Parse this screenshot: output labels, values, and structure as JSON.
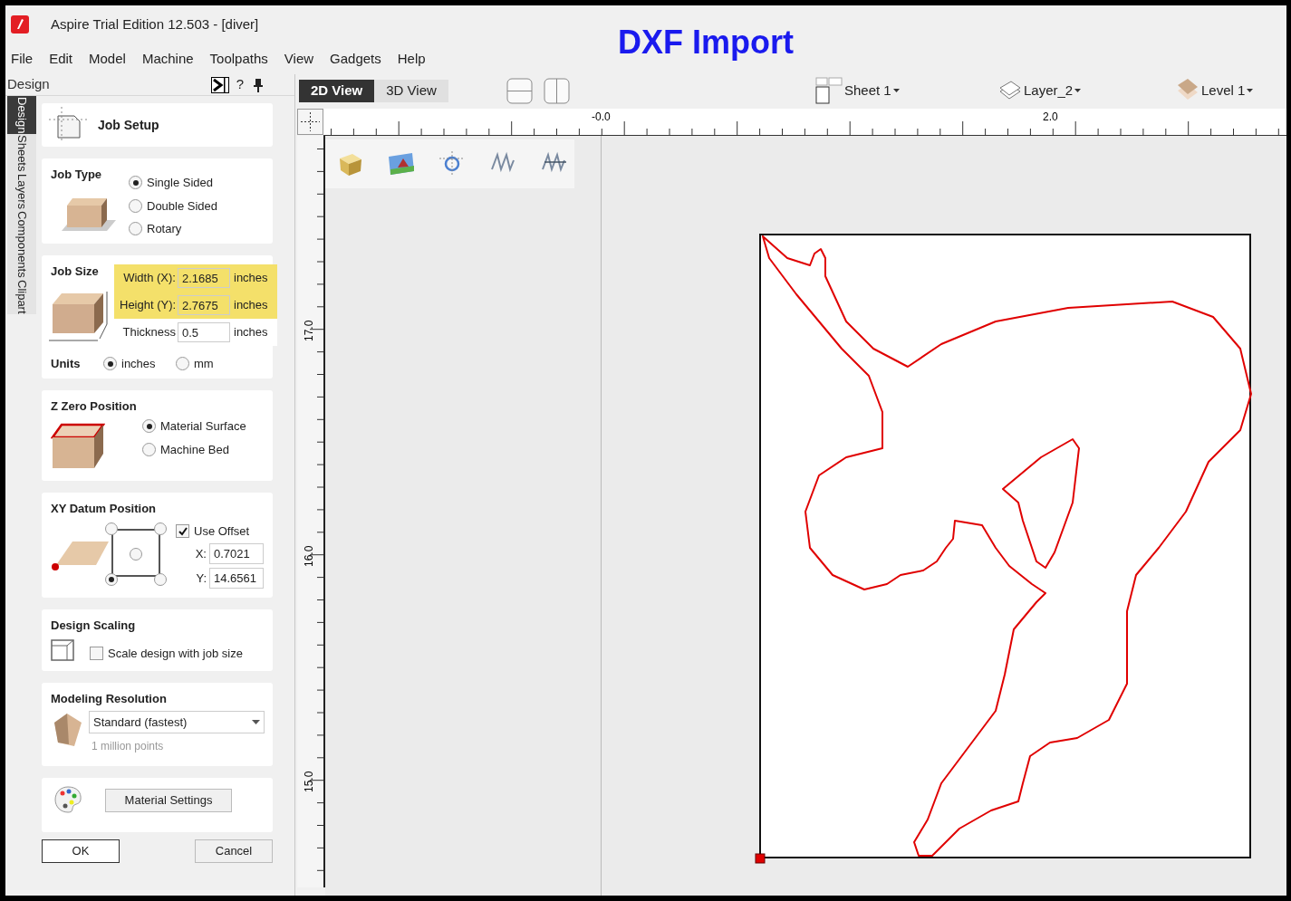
{
  "window": {
    "title": "Aspire Trial Edition 12.503 - [diver]"
  },
  "overlay_heading": "DXF Import",
  "menu": [
    "File",
    "Edit",
    "Model",
    "Machine",
    "Toolpaths",
    "View",
    "Gadgets",
    "Help"
  ],
  "panel": {
    "title": "Design",
    "help": "?",
    "side_tabs": [
      {
        "label": "Design",
        "selected": true
      },
      {
        "label": "Sheets",
        "selected": false
      },
      {
        "label": "Layers",
        "selected": false
      },
      {
        "label": "Components",
        "selected": false
      },
      {
        "label": "Clipart",
        "selected": false
      }
    ],
    "job_setup_title": "Job Setup",
    "job_type": {
      "title": "Job Type",
      "options": [
        {
          "label": "Single Sided",
          "selected": true
        },
        {
          "label": "Double Sided",
          "selected": false
        },
        {
          "label": "Rotary",
          "selected": false
        }
      ]
    },
    "job_size": {
      "title": "Job Size",
      "fields": [
        {
          "label": "Width (X):",
          "value": "2.1685",
          "unit": "inches",
          "highlighted": true
        },
        {
          "label": "Height (Y):",
          "value": "2.7675",
          "unit": "inches",
          "highlighted": true
        },
        {
          "label": "Thickness",
          "value": "0.5",
          "unit": "inches",
          "highlighted": false
        }
      ],
      "units_label": "Units",
      "units": [
        {
          "label": "inches",
          "selected": true
        },
        {
          "label": "mm",
          "selected": false
        }
      ]
    },
    "z_zero": {
      "title": "Z Zero Position",
      "options": [
        {
          "label": "Material Surface",
          "selected": true
        },
        {
          "label": "Machine Bed",
          "selected": false
        }
      ]
    },
    "xy_datum": {
      "title": "XY Datum Position",
      "anchors": [
        {
          "selected": false
        },
        {
          "selected": false
        },
        {
          "selected": false
        },
        {
          "selected": true
        },
        {
          "selected": false
        }
      ],
      "use_offset": {
        "label": "Use Offset",
        "checked": true
      },
      "fields": [
        {
          "label": "X:",
          "value": "0.7021"
        },
        {
          "label": "Y:",
          "value": "14.6561"
        }
      ]
    },
    "design_scaling": {
      "title": "Design Scaling",
      "label": "Scale design with job size",
      "checked": false
    },
    "modeling_resolution": {
      "title": "Modeling Resolution",
      "value": "Standard (fastest)",
      "note": "1 million points"
    },
    "material_button": "Material Settings",
    "buttons": [
      "OK",
      "Cancel"
    ]
  },
  "view_tabs": [
    {
      "label": "2D View",
      "selected": true
    },
    {
      "label": "3D View",
      "selected": false
    }
  ],
  "sheet": "Sheet 1",
  "layer": "Layer_2",
  "level": "Level 1",
  "ruler": {
    "horizontal": [
      "-0.0",
      "2.0"
    ],
    "vertical": [
      "17.0",
      "16.0",
      "15.0"
    ]
  }
}
